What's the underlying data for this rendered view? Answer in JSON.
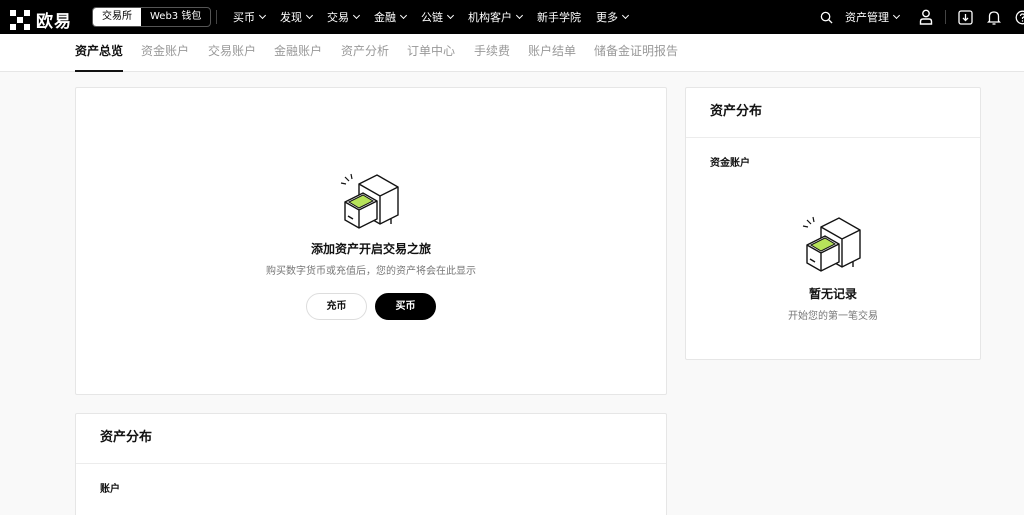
{
  "brand": {
    "name": "欧易"
  },
  "mode_switch": {
    "exchange": "交易所",
    "web3": "Web3 钱包"
  },
  "nav": [
    {
      "label": "买币",
      "dropdown": true
    },
    {
      "label": "发现",
      "dropdown": true
    },
    {
      "label": "交易",
      "dropdown": true
    },
    {
      "label": "金融",
      "dropdown": true
    },
    {
      "label": "公链",
      "dropdown": true
    },
    {
      "label": "机构客户",
      "dropdown": true
    },
    {
      "label": "新手学院",
      "dropdown": false
    },
    {
      "label": "更多",
      "dropdown": true
    }
  ],
  "top_right": {
    "asset_mgmt": "资产管理"
  },
  "tabs": [
    {
      "label": "资产总览",
      "active": true
    },
    {
      "label": "资金账户"
    },
    {
      "label": "交易账户"
    },
    {
      "label": "金融账户"
    },
    {
      "label": "资产分析"
    },
    {
      "label": "订单中心"
    },
    {
      "label": "手续费"
    },
    {
      "label": "账户结单"
    },
    {
      "label": "储备金证明报告"
    }
  ],
  "empty_assets": {
    "title": "添加资产开启交易之旅",
    "desc": "购买数字货币或充值后，您的资产将会在此显示",
    "deposit_label": "充币",
    "buy_label": "买币"
  },
  "distribution_right": {
    "title": "资产分布",
    "subtitle": "资金账户",
    "empty_title": "暂无记录",
    "empty_desc": "开始您的第一笔交易"
  },
  "distribution_bottom": {
    "title": "资产分布",
    "subtitle": "账户"
  },
  "colors": {
    "accent_green": "#b7e35a",
    "black": "#000000"
  }
}
